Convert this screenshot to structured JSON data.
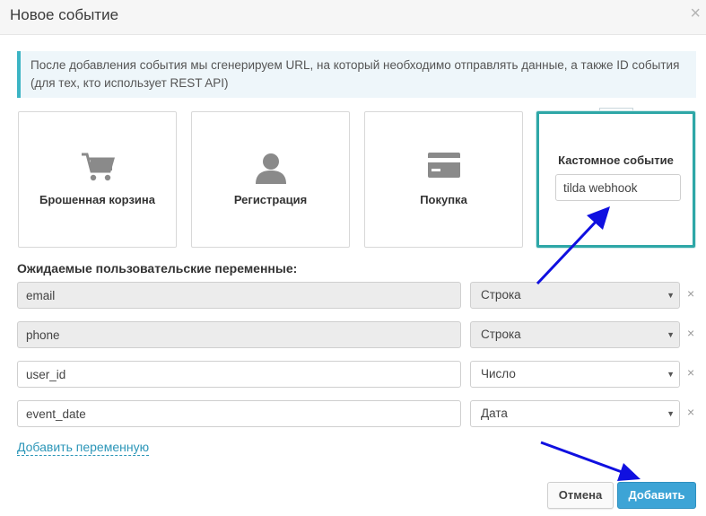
{
  "dialog": {
    "title": "Новое событие",
    "close_icon": "×"
  },
  "info": {
    "text": "После добавления события мы сгенерируем URL, на который необходимо отправлять данные, а также ID события (для тех, кто использует REST API)"
  },
  "event_types": [
    {
      "label": "Брошенная корзина",
      "icon": "cart-icon"
    },
    {
      "label": "Регистрация",
      "icon": "user-icon"
    },
    {
      "label": "Покупка",
      "icon": "credit-card-icon"
    },
    {
      "label": "Кастомное событие",
      "input_value": "tilda webhook",
      "selected": true
    }
  ],
  "variables": {
    "section_label": "Ожидаемые пользовательские переменные:",
    "rows": [
      {
        "name": "email",
        "type": "Строка",
        "disabled": true
      },
      {
        "name": "phone",
        "type": "Строка",
        "disabled": true
      },
      {
        "name": "user_id",
        "type": "Число",
        "disabled": false
      },
      {
        "name": "event_date",
        "type": "Дата",
        "disabled": false
      }
    ],
    "caret": "▼",
    "remove_icon": "×",
    "add_link": "Добавить переменную"
  },
  "footer": {
    "cancel_label": "Отмена",
    "add_label": "Добавить"
  },
  "colors": {
    "accent": "#2ea7a7",
    "primary_button": "#3da4d6",
    "link": "#2c96b8",
    "annotation_arrow": "#1010e0"
  }
}
